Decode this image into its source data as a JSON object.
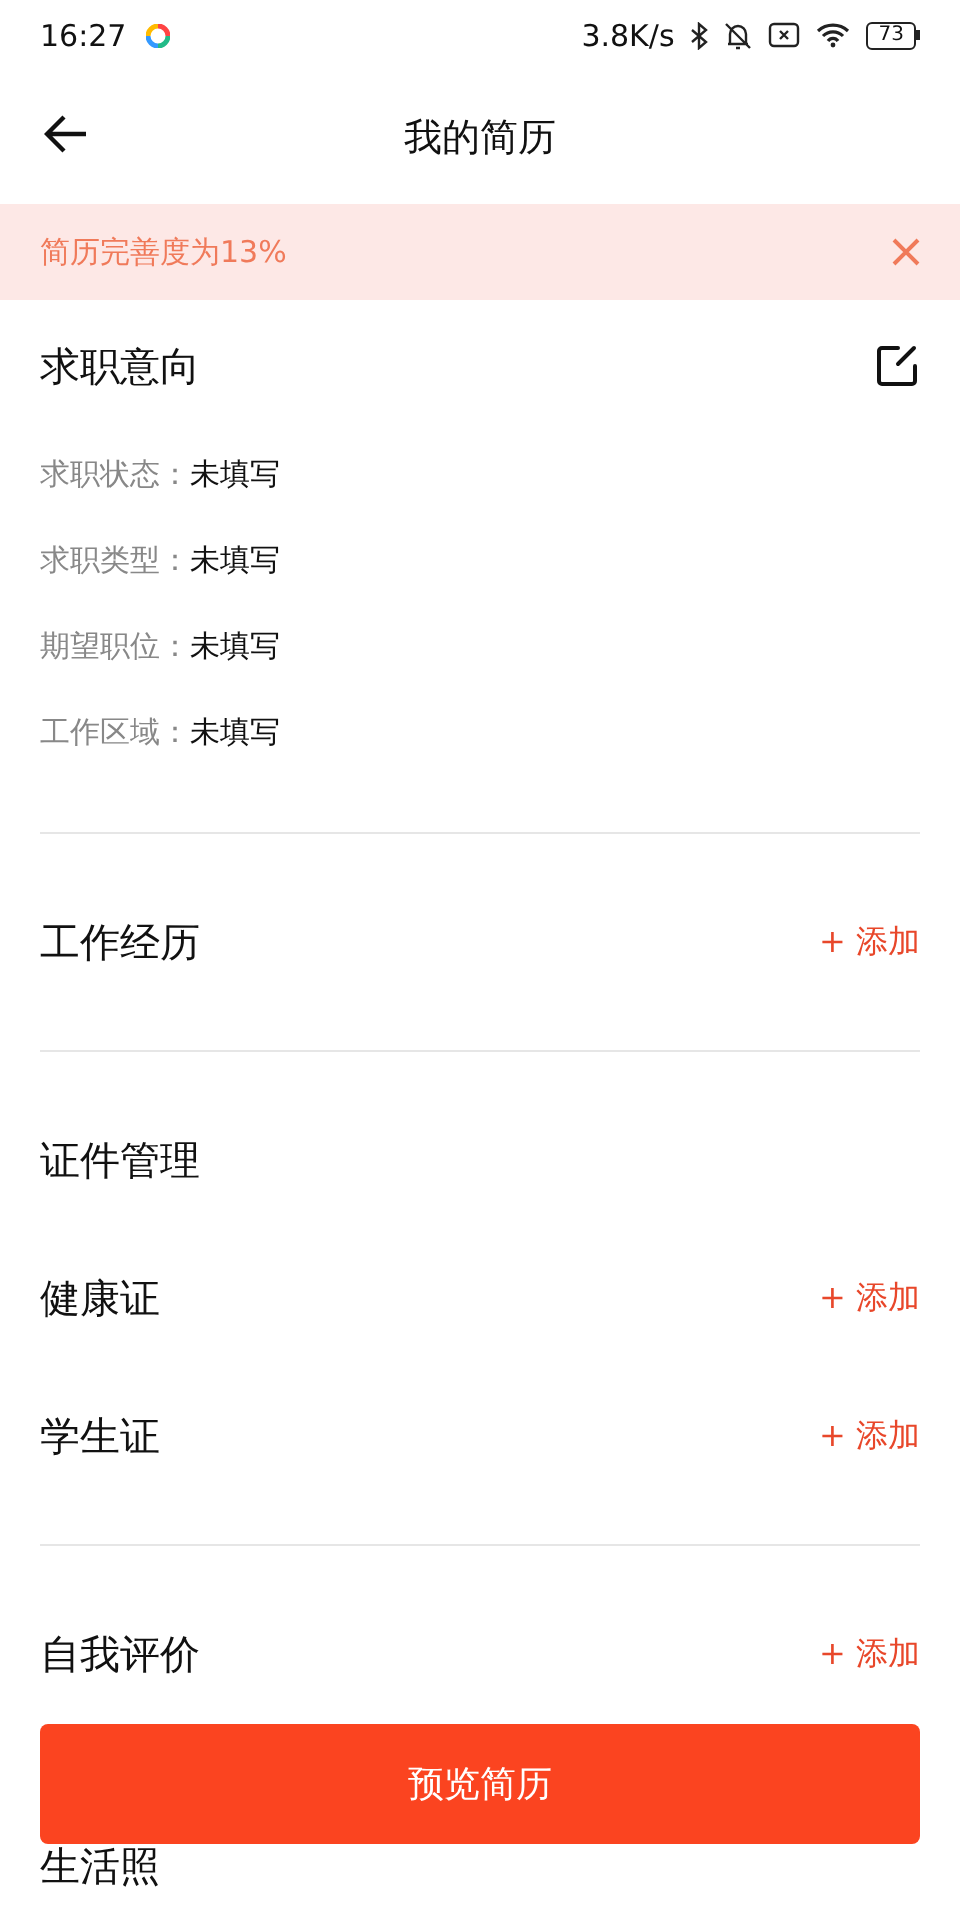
{
  "status_bar": {
    "time": "16:27",
    "speed": "3.8K/s",
    "battery": "73"
  },
  "header": {
    "title": "我的简历"
  },
  "banner": {
    "text": "简历完善度为13%"
  },
  "sections": [
    {
      "kind": "fields",
      "title": "求职意向",
      "fields": [
        {
          "label": "求职状态：",
          "value": "未填写"
        },
        {
          "label": "求职类型：",
          "value": "未填写"
        },
        {
          "label": "期望职位：",
          "value": "未填写"
        },
        {
          "label": "工作区域：",
          "value": "未填写"
        }
      ]
    },
    {
      "kind": "add",
      "title": "工作经历",
      "action": "+ 添加"
    },
    {
      "kind": "items",
      "title": "证件管理",
      "items": [
        {
          "title": "健康证",
          "action": "+ 添加"
        },
        {
          "title": "学生证",
          "action": "+ 添加"
        }
      ]
    },
    {
      "kind": "add",
      "title": "自我评价",
      "action": "+ 添加"
    },
    {
      "kind": "plain",
      "title": "生活照"
    }
  ],
  "primary_button": {
    "label": "预览简历"
  }
}
